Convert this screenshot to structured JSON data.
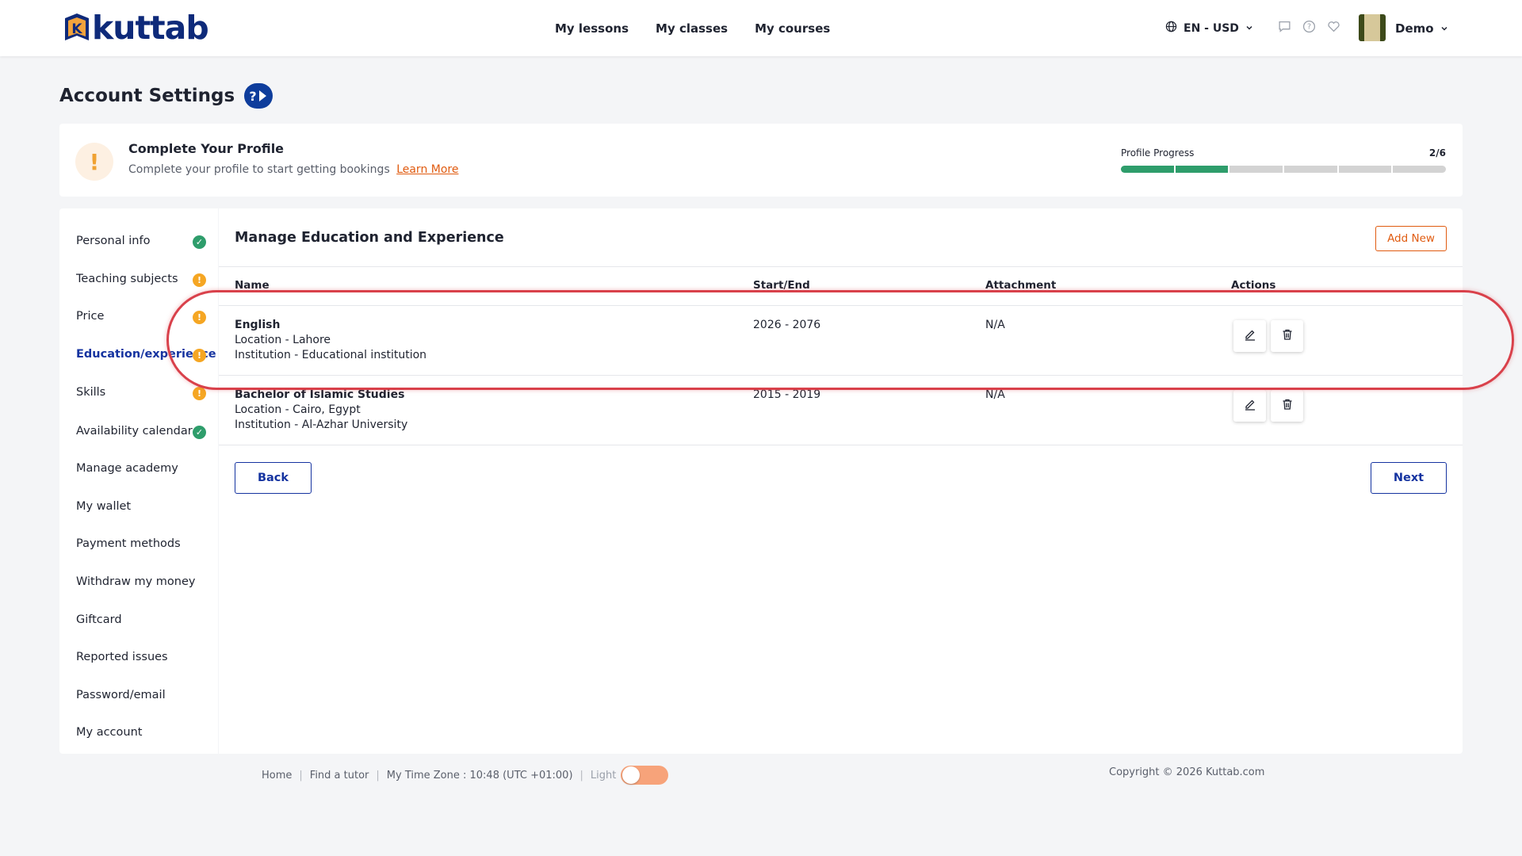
{
  "header": {
    "logo_text": "kuttab",
    "nav": [
      "My lessons",
      "My classes",
      "My courses"
    ],
    "lang_currency": "EN - USD",
    "user_name": "Demo"
  },
  "page": {
    "title": "Account Settings"
  },
  "profile": {
    "title": "Complete Your Profile",
    "subtitle": "Complete your profile to start getting bookings",
    "learn_more": "Learn More",
    "progress_label": "Profile Progress",
    "progress_text": "2/6",
    "progress_done": 2,
    "progress_total": 6
  },
  "sidebar": {
    "items": [
      {
        "label": "Personal info",
        "status": "ok"
      },
      {
        "label": "Teaching subjects",
        "status": "warn"
      },
      {
        "label": "Price",
        "status": "warn"
      },
      {
        "label": "Education/experience",
        "status": "warn",
        "active": true
      },
      {
        "label": "Skills",
        "status": "warn"
      },
      {
        "label": "Availability calendar",
        "status": "ok"
      },
      {
        "label": "Manage academy"
      },
      {
        "label": "My wallet"
      },
      {
        "label": "Payment methods"
      },
      {
        "label": "Withdraw my money"
      },
      {
        "label": "Giftcard"
      },
      {
        "label": "Reported issues"
      },
      {
        "label": "Password/email"
      },
      {
        "label": "My account"
      }
    ]
  },
  "main": {
    "title": "Manage Education and Experience",
    "add_label": "Add New",
    "columns": [
      "Name",
      "Start/End",
      "Attachment",
      "Actions"
    ],
    "rows": [
      {
        "name": "English",
        "location": "Location - Lahore",
        "institution": "Institution - Educational institution",
        "dates": "2026 - 2076",
        "attachment": "N/A"
      },
      {
        "name": "Bachelor of Islamic Studies",
        "location": "Location - Cairo, Egypt",
        "institution": "Institution - Al-Azhar University",
        "dates": "2015 - 2019",
        "attachment": "N/A"
      }
    ],
    "back_label": "Back",
    "next_label": "Next"
  },
  "footer": {
    "home": "Home",
    "find_tutor": "Find a tutor",
    "timezone": "My Time Zone : 10:48 (UTC +01:00)",
    "theme_label": "Light",
    "copyright": "Copyright © 2026 Kuttab.com"
  },
  "colors": {
    "brand_blue": "#0e2a7a",
    "accent_orange": "#e05b10",
    "success_green": "#2e9d6b",
    "warning_amber": "#f5a623",
    "highlight_red": "#d9414b"
  }
}
